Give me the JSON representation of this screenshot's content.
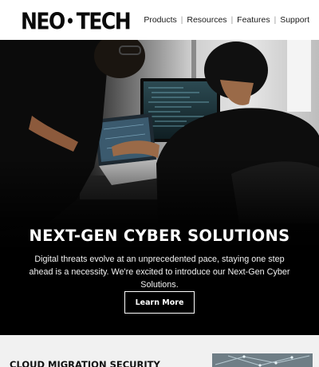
{
  "header": {
    "logo_left": "NEO",
    "logo_right": "TECH",
    "nav": [
      "Products",
      "Resources",
      "Features",
      "Support"
    ],
    "nav_separator": "|"
  },
  "hero": {
    "title": "NEXT-GEN CYBER SOLUTIONS",
    "text": "Digital threats evolve at an unprecedented pace, staying one step ahead is a necessity. We're excited to introduce our Next-Gen Cyber Solutions.",
    "button_label": "Learn More"
  },
  "section": {
    "title": "CLOUD MIGRATION SECURITY"
  },
  "colors": {
    "hero_bg": "#000000",
    "page_bg": "#ffffff",
    "section_bg": "#f1f1f1",
    "text_light": "#ffffff"
  }
}
